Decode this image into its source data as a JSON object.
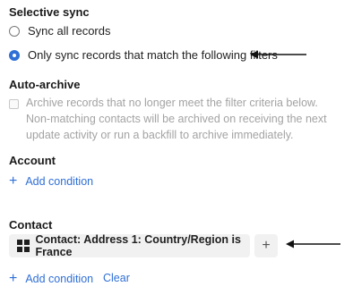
{
  "selective_sync": {
    "title": "Selective sync",
    "options": [
      {
        "label": "Sync all records",
        "checked": false
      },
      {
        "label": "Only sync records that match the following filters",
        "checked": true
      }
    ]
  },
  "auto_archive": {
    "title": "Auto-archive",
    "description": "Archive records that no longer meet the filter criteria below. Non-matching contacts will be archived on receiving the next update activity or run a backfill to archive immediately.",
    "checked": false
  },
  "account": {
    "title": "Account",
    "add_condition_label": "Add condition"
  },
  "contact": {
    "title": "Contact",
    "filter_chip_label": "Contact: Address 1: Country/Region is France",
    "add_condition_label": "Add condition",
    "clear_label": "Clear"
  },
  "colors": {
    "accent": "#2f6fd6",
    "chip_bg": "#f1f1f1",
    "muted_text": "#a3a3a3"
  },
  "icons": [
    "plus-icon",
    "grid-icon",
    "arrow-left-icon"
  ]
}
